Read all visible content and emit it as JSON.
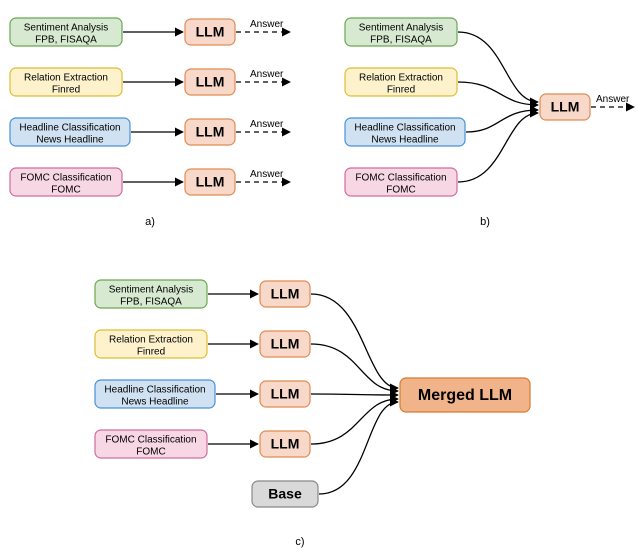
{
  "colors": {
    "green_fill": "#d7ead1",
    "green_stroke": "#6aa84f",
    "yellow_fill": "#fdf2cc",
    "yellow_stroke": "#e0bd33",
    "blue_fill": "#d0e2f2",
    "blue_stroke": "#4a90d9",
    "pink_fill": "#f6d7e3",
    "pink_stroke": "#d36b9e",
    "orange_fill": "#f7d8c9",
    "orange_stroke": "#e08b55",
    "orange_merged_fill": "#f0b38a",
    "orange_merged_stroke": "#d97a2f",
    "grey_fill": "#d9d9d9",
    "grey_stroke": "#888"
  },
  "tasks": {
    "sentiment": {
      "line1": "Sentiment Analysis",
      "line2": "FPB, FISAQA"
    },
    "relation": {
      "line1": "Relation Extraction",
      "line2": "Finred"
    },
    "headline": {
      "line1": "Headline Classification",
      "line2": "News Headline"
    },
    "fomc": {
      "line1": "FOMC Classification",
      "line2": "FOMC"
    }
  },
  "llm_label": "LLM",
  "merged_label": "Merged LLM",
  "base_label": "Base",
  "answer_label": "Answer",
  "panel_labels": {
    "a": "a)",
    "b": "b)",
    "c": "c)"
  }
}
